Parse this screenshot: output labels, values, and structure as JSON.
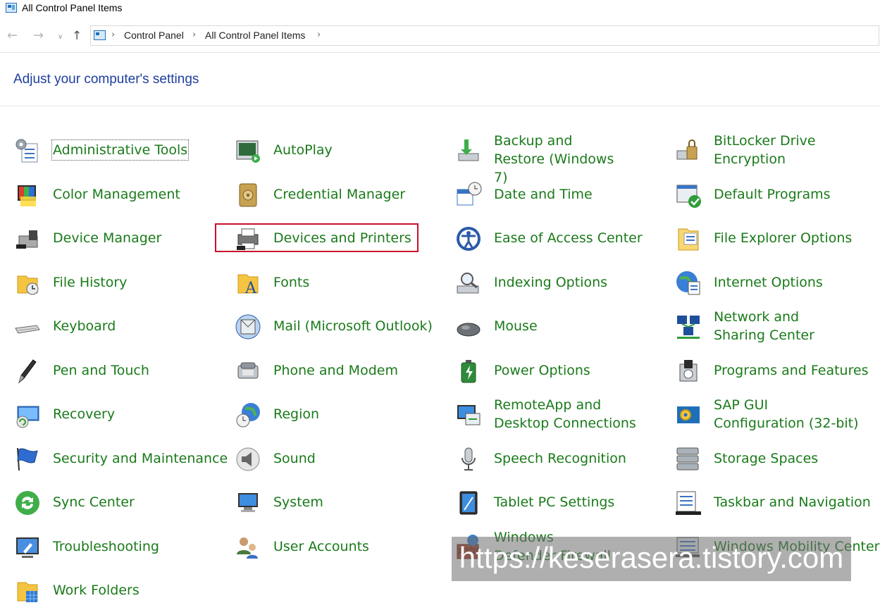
{
  "window": {
    "title": "All Control Panel Items"
  },
  "breadcrumb": [
    "Control Panel",
    "All Control Panel Items"
  ],
  "heading": "Adjust your computer's settings",
  "columns": [
    [
      {
        "label": "Administrative Tools",
        "icon": "admin-tools-icon",
        "focused": true
      },
      {
        "label": "Color Management",
        "icon": "color-management-icon"
      },
      {
        "label": "Device Manager",
        "icon": "device-manager-icon"
      },
      {
        "label": "File History",
        "icon": "file-history-icon"
      },
      {
        "label": "Keyboard",
        "icon": "keyboard-icon"
      },
      {
        "label": "Pen and Touch",
        "icon": "pen-icon"
      },
      {
        "label": "Recovery",
        "icon": "recovery-icon"
      },
      {
        "label": "Security and Maintenance",
        "icon": "flag-icon"
      },
      {
        "label": "Sync Center",
        "icon": "sync-icon"
      },
      {
        "label": "Troubleshooting",
        "icon": "troubleshooting-icon"
      },
      {
        "label": "Work Folders",
        "icon": "work-folders-icon"
      }
    ],
    [
      {
        "label": "AutoPlay",
        "icon": "autoplay-icon"
      },
      {
        "label": "Credential Manager",
        "icon": "credential-vault-icon"
      },
      {
        "label": "Devices and Printers",
        "icon": "printer-icon",
        "highlighted": true
      },
      {
        "label": "Fonts",
        "icon": "fonts-icon"
      },
      {
        "label": "Mail (Microsoft Outlook)",
        "icon": "mail-icon"
      },
      {
        "label": "Phone and Modem",
        "icon": "phone-icon"
      },
      {
        "label": "Region",
        "icon": "globe-clock-icon"
      },
      {
        "label": "Sound",
        "icon": "speaker-icon"
      },
      {
        "label": "System",
        "icon": "system-monitor-icon"
      },
      {
        "label": "User Accounts",
        "icon": "users-icon"
      }
    ],
    [
      {
        "label": "Backup and Restore (Windows 7)",
        "icon": "backup-icon"
      },
      {
        "label": "Date and Time",
        "icon": "calendar-clock-icon"
      },
      {
        "label": "Ease of Access Center",
        "icon": "ease-of-access-icon"
      },
      {
        "label": "Indexing Options",
        "icon": "indexing-icon"
      },
      {
        "label": "Mouse",
        "icon": "mouse-icon"
      },
      {
        "label": "Power Options",
        "icon": "battery-icon"
      },
      {
        "label": "RemoteApp and Desktop Connections",
        "icon": "remoteapp-icon"
      },
      {
        "label": "Speech Recognition",
        "icon": "microphone-icon"
      },
      {
        "label": "Tablet PC Settings",
        "icon": "tablet-icon"
      },
      {
        "label": "Windows Defender Firewall",
        "icon": "firewall-icon"
      }
    ],
    [
      {
        "label": "BitLocker Drive Encryption",
        "icon": "bitlocker-icon"
      },
      {
        "label": "Default Programs",
        "icon": "default-programs-icon"
      },
      {
        "label": "File Explorer Options",
        "icon": "folder-options-icon"
      },
      {
        "label": "Internet Options",
        "icon": "internet-options-icon"
      },
      {
        "label": "Network and Sharing Center",
        "icon": "network-icon"
      },
      {
        "label": "Programs and Features",
        "icon": "programs-icon"
      },
      {
        "label": "SAP GUI Configuration (32-bit)",
        "icon": "sap-gui-icon"
      },
      {
        "label": "Storage Spaces",
        "icon": "storage-icon"
      },
      {
        "label": "Taskbar and Navigation",
        "icon": "taskbar-icon"
      },
      {
        "label": "Windows Mobility Center",
        "icon": "mobility-icon"
      }
    ]
  ],
  "watermark": "https://keserasera.tistory.com",
  "colors": {
    "link": "#1a7a1a",
    "heading": "#1e3e9e",
    "highlight": "#c8102e"
  }
}
